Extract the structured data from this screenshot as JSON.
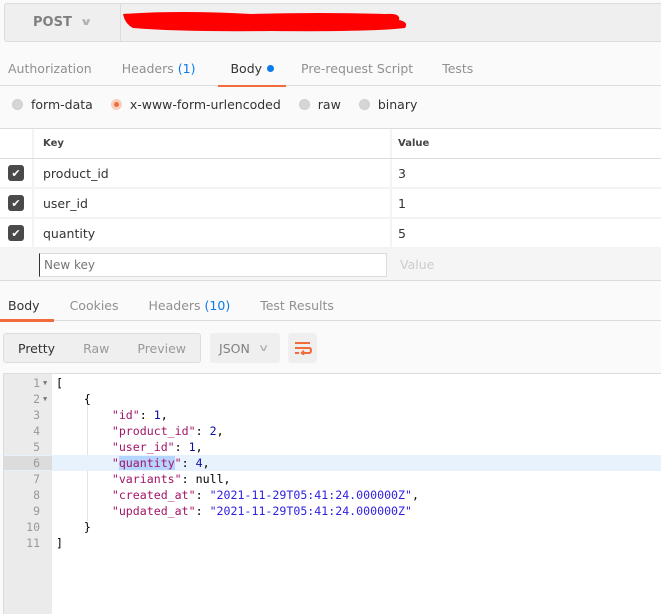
{
  "request": {
    "method": "POST",
    "url_redacted": true,
    "tabs": [
      {
        "label": "Authorization",
        "badge": ""
      },
      {
        "label": "Headers",
        "badge": "(1)"
      },
      {
        "label": "Body",
        "badge": "",
        "active": true,
        "dot": true
      },
      {
        "label": "Pre-request Script",
        "badge": ""
      },
      {
        "label": "Tests",
        "badge": ""
      }
    ],
    "body_types": [
      {
        "label": "form-data",
        "selected": false
      },
      {
        "label": "x-www-form-urlencoded",
        "selected": true
      },
      {
        "label": "raw",
        "selected": false
      },
      {
        "label": "binary",
        "selected": false
      }
    ],
    "params": {
      "headers": {
        "key": "Key",
        "value": "Value"
      },
      "rows": [
        {
          "checked": true,
          "key": "product_id",
          "value": "3"
        },
        {
          "checked": true,
          "key": "user_id",
          "value": "1"
        },
        {
          "checked": true,
          "key": "quantity",
          "value": "5"
        }
      ],
      "new_key_placeholder": "New key",
      "new_value_placeholder": "Value"
    }
  },
  "response": {
    "tabs": [
      {
        "label": "Body",
        "badge": "",
        "active": true
      },
      {
        "label": "Cookies",
        "badge": ""
      },
      {
        "label": "Headers",
        "badge": "(10)"
      },
      {
        "label": "Test Results",
        "badge": ""
      }
    ],
    "view_modes": [
      {
        "label": "Pretty",
        "active": true
      },
      {
        "label": "Raw",
        "active": false
      },
      {
        "label": "Preview",
        "active": false
      }
    ],
    "format": "JSON",
    "wrap_icon": "wrap-lines-icon",
    "highlighted_line": 6,
    "selected_text": "quantity",
    "lines": [
      {
        "n": "1",
        "fold": true
      },
      {
        "n": "2",
        "fold": true
      },
      {
        "n": "3"
      },
      {
        "n": "4"
      },
      {
        "n": "5"
      },
      {
        "n": "6"
      },
      {
        "n": "7"
      },
      {
        "n": "8"
      },
      {
        "n": "9"
      },
      {
        "n": "10"
      },
      {
        "n": "11"
      }
    ],
    "json": {
      "open_array": "[",
      "open_obj": "{",
      "fields": [
        {
          "key": "\"id\"",
          "value": "1",
          "type": "number",
          "comma": ","
        },
        {
          "key": "\"product_id\"",
          "value": "2",
          "type": "number",
          "comma": ","
        },
        {
          "key": "\"user_id\"",
          "value": "1",
          "type": "number",
          "comma": ","
        },
        {
          "key_pre": "\"",
          "key_sel": "quantity",
          "key_post": "\"",
          "value": "4",
          "type": "number",
          "comma": ","
        },
        {
          "key": "\"variants\"",
          "value": "null",
          "type": "null",
          "comma": ","
        },
        {
          "key": "\"created_at\"",
          "value": "\"2021-11-29T05:41:24.000000Z\"",
          "type": "string",
          "comma": ","
        },
        {
          "key": "\"updated_at\"",
          "value": "\"2021-11-29T05:41:24.000000Z\"",
          "type": "string",
          "comma": ""
        }
      ],
      "close_obj": "}",
      "close_array": "]"
    }
  },
  "colors": {
    "accent": "#f26b3a",
    "link_blue": "#097bed",
    "json_key": "#a31567",
    "json_number": "#0b0e9e",
    "json_string": "#3020e0"
  }
}
